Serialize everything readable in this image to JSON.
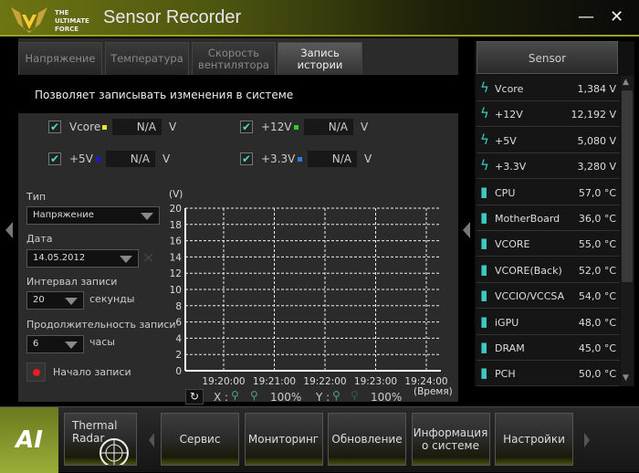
{
  "window": {
    "title": "Sensor Recorder",
    "logo_text": "THE ULTIMATE FORCE",
    "minimize": "—",
    "close": "✕"
  },
  "tabs": [
    {
      "label": "Напряжение"
    },
    {
      "label": "Температура"
    },
    {
      "label": "Скорость вентилятора"
    },
    {
      "label": "Запись истории",
      "active": true
    }
  ],
  "description": "Позволяет записывать изменения в системе",
  "channels": [
    {
      "name": "Vcore",
      "value": "N/A",
      "unit": "V",
      "checked": true,
      "color": "#e6e62a"
    },
    {
      "name": "+12V",
      "value": "N/A",
      "unit": "V",
      "checked": true,
      "color": "#2ad02a"
    },
    {
      "name": "+5V",
      "value": "N/A",
      "unit": "V",
      "checked": true,
      "color": "#1a1ad8"
    },
    {
      "name": "+3.3V",
      "value": "N/A",
      "unit": "V",
      "checked": true,
      "color": "#2a7ae8"
    }
  ],
  "form": {
    "type_label": "Тип",
    "type_value": "Напряжение",
    "date_label": "Дата",
    "date_value": "14.05.2012",
    "interval_label": "Интервал записи",
    "interval_value": "20",
    "interval_unit": "секунды",
    "duration_label": "Продолжительность записи",
    "duration_value": "6",
    "duration_unit": "часы",
    "record_label": "Начало записи"
  },
  "chart_data": {
    "type": "line",
    "ylabel": "(V)",
    "xlabel": "(Время)",
    "ylim": [
      0,
      20
    ],
    "yticks": [
      "0",
      "2",
      "4",
      "6",
      "8",
      "10",
      "12",
      "14",
      "16",
      "18",
      "20"
    ],
    "xticks": [
      "19:20:00",
      "19:21:00",
      "19:22:00",
      "19:23:00",
      "19:24:00"
    ],
    "grid": true,
    "series": []
  },
  "zoom": {
    "x_label": "X :",
    "x_percent": "100%",
    "y_label": "Y :",
    "y_percent": "100%"
  },
  "sensor_panel": {
    "header": "Sensor",
    "items": [
      {
        "icon": "bolt",
        "name": "Vcore",
        "value": "1,384  V"
      },
      {
        "icon": "bolt",
        "name": "+12V",
        "value": "12,192  V"
      },
      {
        "icon": "bolt",
        "name": "+5V",
        "value": "5,080  V"
      },
      {
        "icon": "bolt",
        "name": "+3.3V",
        "value": "3,280  V"
      },
      {
        "icon": "thermometer",
        "name": "CPU",
        "value": "57,0 °C"
      },
      {
        "icon": "thermometer",
        "name": "MotherBoard",
        "value": "36,0 °C"
      },
      {
        "icon": "thermometer",
        "name": "VCORE",
        "value": "55,0 °C"
      },
      {
        "icon": "thermometer",
        "name": "VCORE(Back)",
        "value": "52,0 °C"
      },
      {
        "icon": "thermometer",
        "name": "VCCIO/VCCSA",
        "value": "54,0 °C"
      },
      {
        "icon": "thermometer",
        "name": "iGPU",
        "value": "48,0 °C"
      },
      {
        "icon": "thermometer",
        "name": "DRAM",
        "value": "45,0 °C"
      },
      {
        "icon": "thermometer",
        "name": "PCH",
        "value": "50,0 °C"
      }
    ]
  },
  "bottom": {
    "logo": "AI",
    "thermal_radar": "Thermal Radar",
    "buttons": [
      "Сервис",
      "Мониторинг",
      "Обновление",
      "Информация о системе",
      "Настройки"
    ]
  },
  "colors": {
    "accent": "#9aa224",
    "icon": "#3ec9c0",
    "record": "#e02020"
  }
}
